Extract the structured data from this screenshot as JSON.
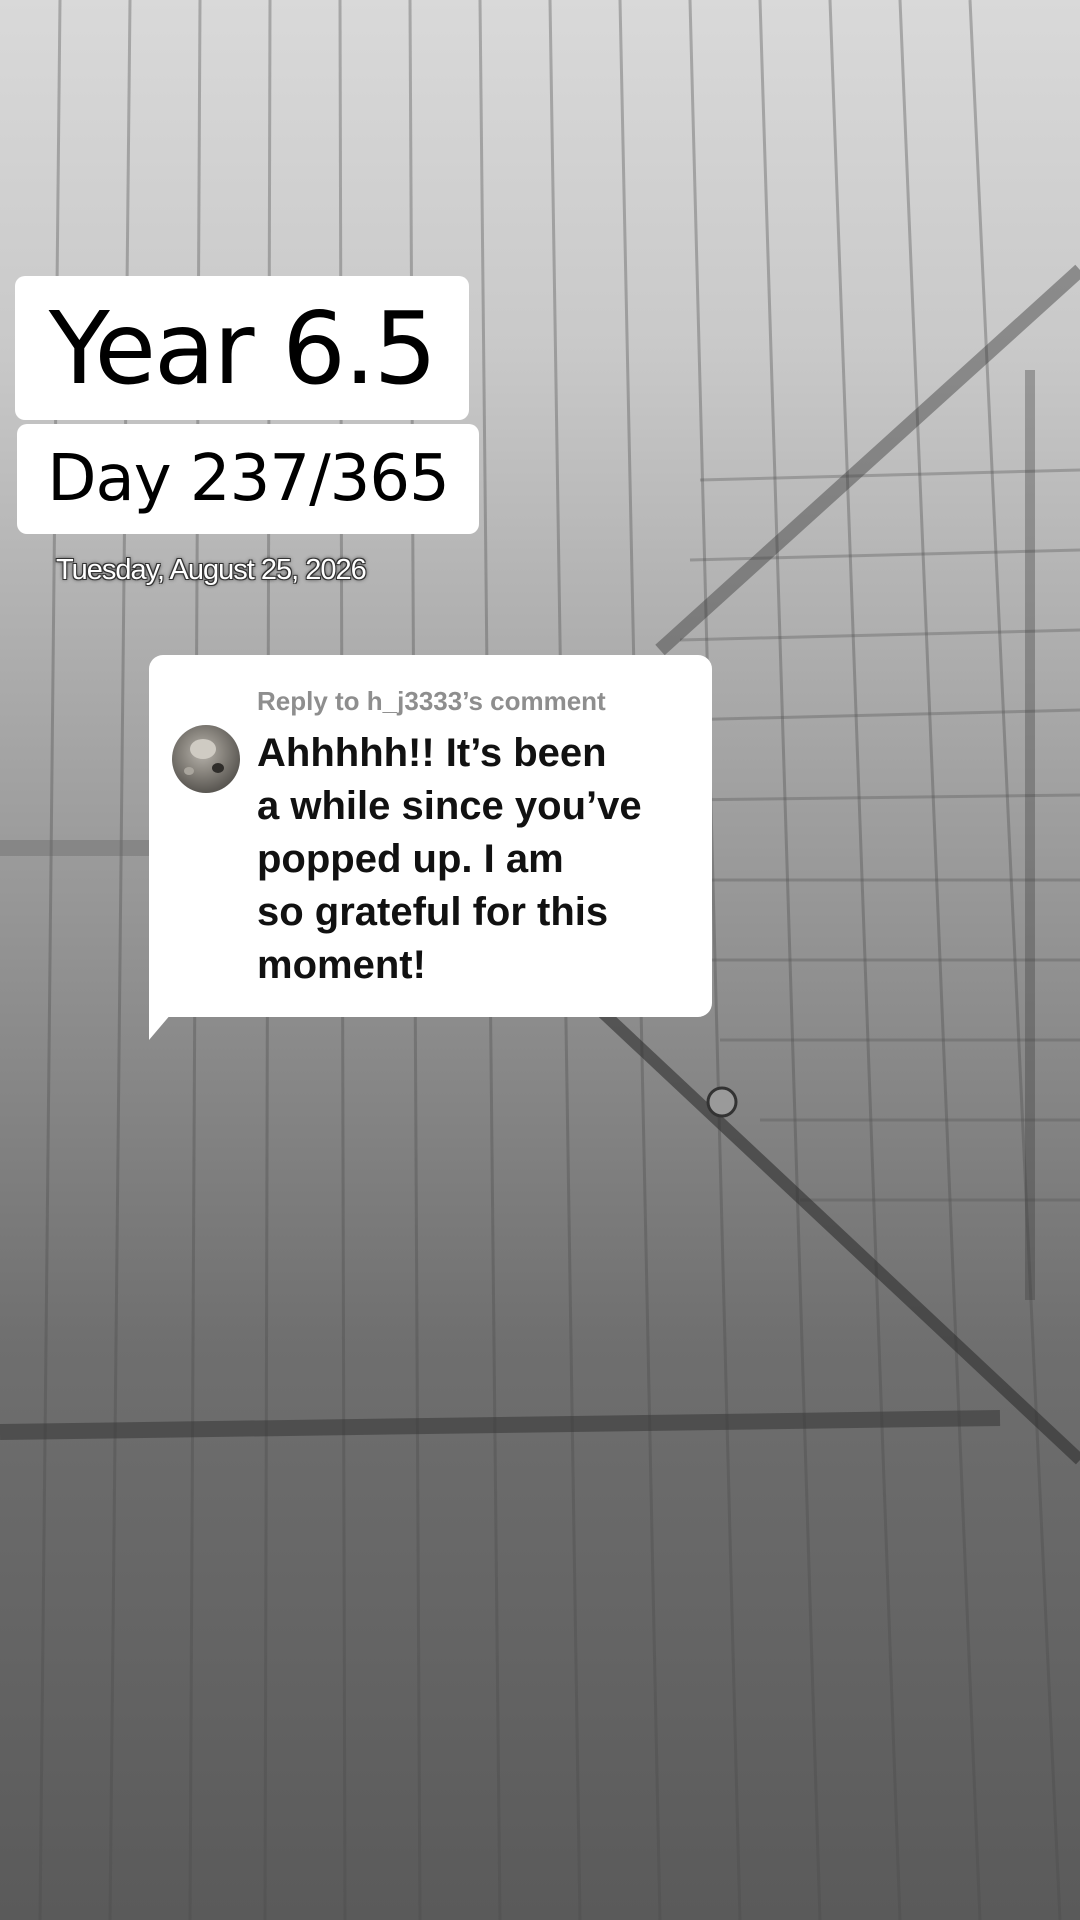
{
  "overlay": {
    "year_label": "Year 6.5",
    "day_label": "Day 237/365",
    "date_label": "Tuesday, August 25, 2026"
  },
  "reply": {
    "header": "Reply to h_j3333’s comment",
    "lines": [
      "Ahhhhh!! It’s been",
      "a while since you’ve",
      "popped up. I am",
      "so grateful for this",
      "moment!"
    ]
  },
  "colors": {
    "card_background": "#ffffff",
    "header_gray": "#8e8e8e",
    "text_dark": "#111111"
  }
}
